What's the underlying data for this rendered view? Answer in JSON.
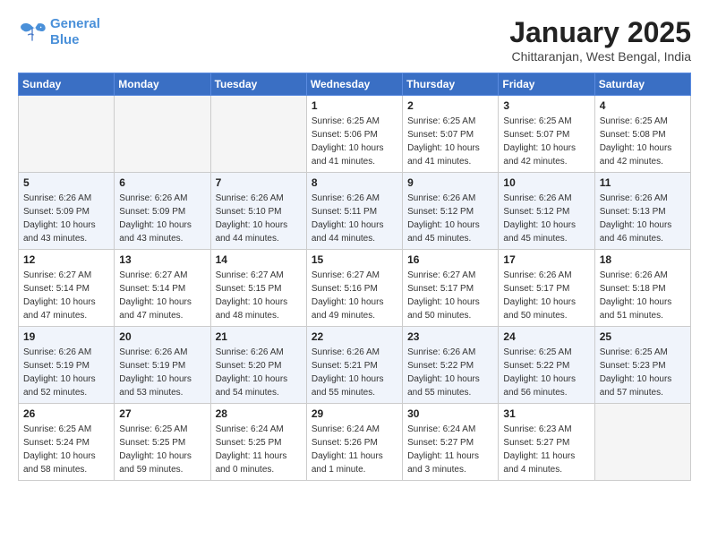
{
  "header": {
    "logo_line1": "General",
    "logo_line2": "Blue",
    "month_title": "January 2025",
    "subtitle": "Chittaranjan, West Bengal, India"
  },
  "weekdays": [
    "Sunday",
    "Monday",
    "Tuesday",
    "Wednesday",
    "Thursday",
    "Friday",
    "Saturday"
  ],
  "weeks": [
    [
      {
        "day": "",
        "info": ""
      },
      {
        "day": "",
        "info": ""
      },
      {
        "day": "",
        "info": ""
      },
      {
        "day": "1",
        "info": "Sunrise: 6:25 AM\nSunset: 5:06 PM\nDaylight: 10 hours\nand 41 minutes."
      },
      {
        "day": "2",
        "info": "Sunrise: 6:25 AM\nSunset: 5:07 PM\nDaylight: 10 hours\nand 41 minutes."
      },
      {
        "day": "3",
        "info": "Sunrise: 6:25 AM\nSunset: 5:07 PM\nDaylight: 10 hours\nand 42 minutes."
      },
      {
        "day": "4",
        "info": "Sunrise: 6:25 AM\nSunset: 5:08 PM\nDaylight: 10 hours\nand 42 minutes."
      }
    ],
    [
      {
        "day": "5",
        "info": "Sunrise: 6:26 AM\nSunset: 5:09 PM\nDaylight: 10 hours\nand 43 minutes."
      },
      {
        "day": "6",
        "info": "Sunrise: 6:26 AM\nSunset: 5:09 PM\nDaylight: 10 hours\nand 43 minutes."
      },
      {
        "day": "7",
        "info": "Sunrise: 6:26 AM\nSunset: 5:10 PM\nDaylight: 10 hours\nand 44 minutes."
      },
      {
        "day": "8",
        "info": "Sunrise: 6:26 AM\nSunset: 5:11 PM\nDaylight: 10 hours\nand 44 minutes."
      },
      {
        "day": "9",
        "info": "Sunrise: 6:26 AM\nSunset: 5:12 PM\nDaylight: 10 hours\nand 45 minutes."
      },
      {
        "day": "10",
        "info": "Sunrise: 6:26 AM\nSunset: 5:12 PM\nDaylight: 10 hours\nand 45 minutes."
      },
      {
        "day": "11",
        "info": "Sunrise: 6:26 AM\nSunset: 5:13 PM\nDaylight: 10 hours\nand 46 minutes."
      }
    ],
    [
      {
        "day": "12",
        "info": "Sunrise: 6:27 AM\nSunset: 5:14 PM\nDaylight: 10 hours\nand 47 minutes."
      },
      {
        "day": "13",
        "info": "Sunrise: 6:27 AM\nSunset: 5:14 PM\nDaylight: 10 hours\nand 47 minutes."
      },
      {
        "day": "14",
        "info": "Sunrise: 6:27 AM\nSunset: 5:15 PM\nDaylight: 10 hours\nand 48 minutes."
      },
      {
        "day": "15",
        "info": "Sunrise: 6:27 AM\nSunset: 5:16 PM\nDaylight: 10 hours\nand 49 minutes."
      },
      {
        "day": "16",
        "info": "Sunrise: 6:27 AM\nSunset: 5:17 PM\nDaylight: 10 hours\nand 50 minutes."
      },
      {
        "day": "17",
        "info": "Sunrise: 6:26 AM\nSunset: 5:17 PM\nDaylight: 10 hours\nand 50 minutes."
      },
      {
        "day": "18",
        "info": "Sunrise: 6:26 AM\nSunset: 5:18 PM\nDaylight: 10 hours\nand 51 minutes."
      }
    ],
    [
      {
        "day": "19",
        "info": "Sunrise: 6:26 AM\nSunset: 5:19 PM\nDaylight: 10 hours\nand 52 minutes."
      },
      {
        "day": "20",
        "info": "Sunrise: 6:26 AM\nSunset: 5:19 PM\nDaylight: 10 hours\nand 53 minutes."
      },
      {
        "day": "21",
        "info": "Sunrise: 6:26 AM\nSunset: 5:20 PM\nDaylight: 10 hours\nand 54 minutes."
      },
      {
        "day": "22",
        "info": "Sunrise: 6:26 AM\nSunset: 5:21 PM\nDaylight: 10 hours\nand 55 minutes."
      },
      {
        "day": "23",
        "info": "Sunrise: 6:26 AM\nSunset: 5:22 PM\nDaylight: 10 hours\nand 55 minutes."
      },
      {
        "day": "24",
        "info": "Sunrise: 6:25 AM\nSunset: 5:22 PM\nDaylight: 10 hours\nand 56 minutes."
      },
      {
        "day": "25",
        "info": "Sunrise: 6:25 AM\nSunset: 5:23 PM\nDaylight: 10 hours\nand 57 minutes."
      }
    ],
    [
      {
        "day": "26",
        "info": "Sunrise: 6:25 AM\nSunset: 5:24 PM\nDaylight: 10 hours\nand 58 minutes."
      },
      {
        "day": "27",
        "info": "Sunrise: 6:25 AM\nSunset: 5:25 PM\nDaylight: 10 hours\nand 59 minutes."
      },
      {
        "day": "28",
        "info": "Sunrise: 6:24 AM\nSunset: 5:25 PM\nDaylight: 11 hours\nand 0 minutes."
      },
      {
        "day": "29",
        "info": "Sunrise: 6:24 AM\nSunset: 5:26 PM\nDaylight: 11 hours\nand 1 minute."
      },
      {
        "day": "30",
        "info": "Sunrise: 6:24 AM\nSunset: 5:27 PM\nDaylight: 11 hours\nand 3 minutes."
      },
      {
        "day": "31",
        "info": "Sunrise: 6:23 AM\nSunset: 5:27 PM\nDaylight: 11 hours\nand 4 minutes."
      },
      {
        "day": "",
        "info": ""
      }
    ]
  ]
}
